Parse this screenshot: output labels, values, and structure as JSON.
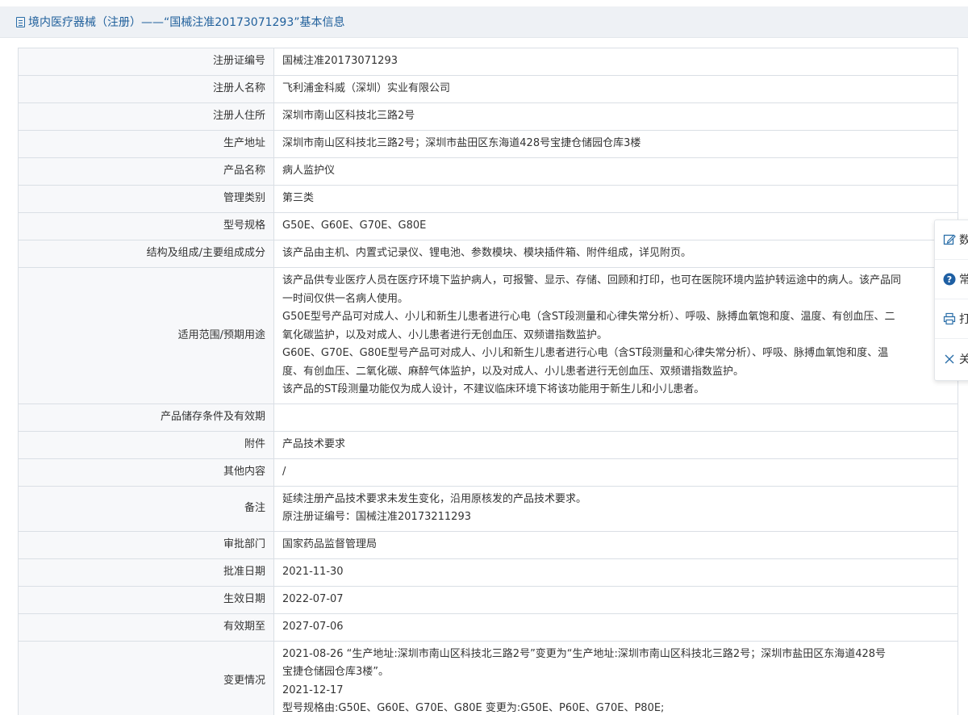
{
  "header": {
    "title": "境内医疗器械（注册）——“国械注准20173071293”基本信息"
  },
  "rows": [
    {
      "label": "注册证编号",
      "lines": [
        "国械注准20173071293"
      ]
    },
    {
      "label": "注册人名称",
      "lines": [
        "飞利浦金科威（深圳）实业有限公司"
      ]
    },
    {
      "label": "注册人住所",
      "lines": [
        "深圳市南山区科技北三路2号"
      ]
    },
    {
      "label": "生产地址",
      "lines": [
        "深圳市南山区科技北三路2号；深圳市盐田区东海道428号宝捷仓储园仓库3楼"
      ]
    },
    {
      "label": "产品名称",
      "lines": [
        "病人监护仪"
      ]
    },
    {
      "label": "管理类别",
      "lines": [
        "第三类"
      ]
    },
    {
      "label": "型号规格",
      "lines": [
        "G50E、G60E、G70E、G80E"
      ]
    },
    {
      "label": "结构及组成/主要组成成分",
      "lines": [
        "该产品由主机、内置式记录仪、锂电池、参数模块、模块插件箱、附件组成，详见附页。"
      ]
    },
    {
      "label": "适用范围/预期用途",
      "lines": [
        "该产品供专业医疗人员在医疗环境下监护病人，可报警、显示、存储、回顾和打印，也可在医院环境内监护转运途中的病人。该产品同",
        "一时间仅供一名病人使用。",
        "G50E型号产品可对成人、小儿和新生儿患者进行心电（含ST段测量和心律失常分析）、呼吸、脉搏血氧饱和度、温度、有创血压、二",
        "氧化碳监护，以及对成人、小儿患者进行无创血压、双频谱指数监护。",
        "G60E、G70E、G80E型号产品可对成人、小儿和新生儿患者进行心电（含ST段测量和心律失常分析）、呼吸、脉搏血氧饱和度、温",
        "度、有创血压、二氧化碳、麻醉气体监护，以及对成人、小儿患者进行无创血压、双频谱指数监护。",
        "该产品的ST段测量功能仅为成人设计，不建议临床环境下将该功能用于新生儿和小儿患者。"
      ]
    },
    {
      "label": "产品储存条件及有效期",
      "lines": [
        ""
      ]
    },
    {
      "label": "附件",
      "lines": [
        "产品技术要求"
      ]
    },
    {
      "label": "其他内容",
      "lines": [
        "/"
      ]
    },
    {
      "label": "备注",
      "lines": [
        "延续注册产品技术要求未发生变化，沿用原核发的产品技术要求。",
        "原注册证编号：国械注准20173211293"
      ]
    },
    {
      "label": "审批部门",
      "lines": [
        "国家药品监督管理局"
      ]
    },
    {
      "label": "批准日期",
      "lines": [
        "2021-11-30"
      ]
    },
    {
      "label": "生效日期",
      "lines": [
        "2022-07-07"
      ]
    },
    {
      "label": "有效期至",
      "lines": [
        "2027-07-06"
      ]
    },
    {
      "label": "变更情况",
      "lines": [
        "2021-08-26 “生产地址:深圳市南山区科技北三路2号”变更为“生产地址:深圳市南山区科技北三路2号；深圳市盐田区东海道428号",
        "宝捷仓储园仓库3楼”。",
        "2021-12-17",
        "型号规格由:G50E、G60E、G70E、G80E 变更为:G50E、P60E、G70E、P80E;"
      ]
    }
  ],
  "float_panel": [
    {
      "label": "数",
      "icon": "edit-icon"
    },
    {
      "label": "常",
      "icon": "help-icon"
    },
    {
      "label": "打",
      "icon": "print-icon"
    },
    {
      "label": "关",
      "icon": "close-icon"
    }
  ]
}
